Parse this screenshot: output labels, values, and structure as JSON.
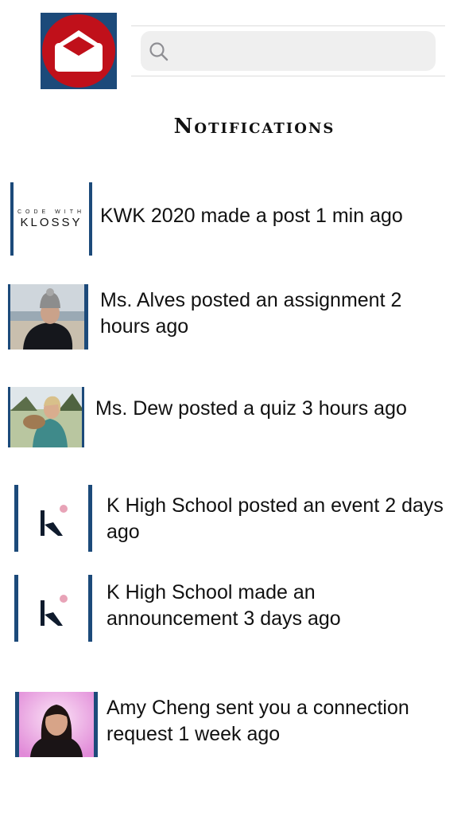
{
  "app": {
    "logo_icon": "envelope-icon",
    "brand_colors": {
      "blue": "#1c4a7a",
      "red": "#c0101a",
      "pink": "#e8a3b7"
    }
  },
  "search": {
    "placeholder": "",
    "value": "",
    "icon": "search-icon"
  },
  "page": {
    "title": "Notifications"
  },
  "notifications": [
    {
      "avatar": "kwk-logo",
      "avatar_small_text": "CODE WITH",
      "avatar_big_text": "KLOSSY",
      "text": "KWK 2020 made a post 1 min ago"
    },
    {
      "avatar": "photo-ms-alves",
      "text": "Ms. Alves posted an assignment 2 hours ago"
    },
    {
      "avatar": "photo-ms-dew",
      "text": "Ms. Dew posted a quiz 3 hours ago"
    },
    {
      "avatar": "k-high-school-logo",
      "text": "K High School posted an event 2 days ago"
    },
    {
      "avatar": "k-high-school-logo",
      "text": "K High School made an announcement 3 days ago"
    },
    {
      "avatar": "photo-amy-cheng",
      "text": "Amy Cheng sent you a connection request 1 week ago"
    }
  ]
}
